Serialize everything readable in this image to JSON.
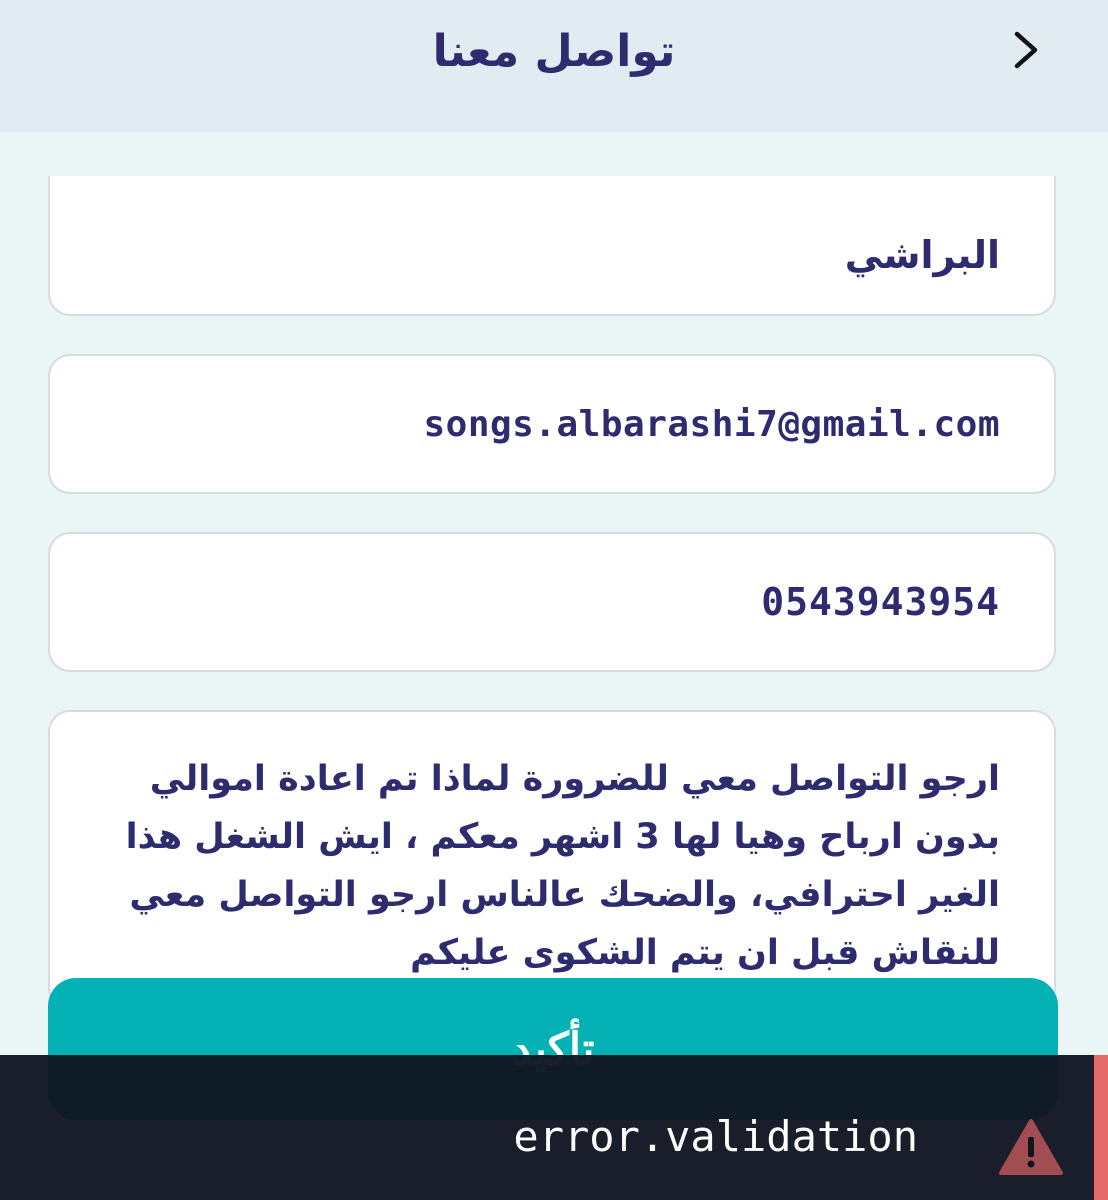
{
  "header": {
    "title": "تواصل معنا"
  },
  "form": {
    "name_value": "البراشي",
    "email_value": "songs.albarashi7@gmail.com",
    "phone_value": "0543943954",
    "message_value": "ارجو التواصل معي للضرورة لماذا تم اعادة اموالي بدون ارباح وهيا لها 3 اشهر معكم ، ايش الشغل هذا الغير احترافي، والضحك عالناس ارجو التواصل معي للنقاش قبل ان يتم الشكوى عليكم"
  },
  "confirm_button": {
    "label": "تأكيد"
  },
  "toast": {
    "message": "error.validation",
    "icon": "warning-icon",
    "accent_color": "#e66a6a"
  },
  "icons": {
    "back": "chevron-right-icon"
  },
  "colors": {
    "header_bg": "#e0ebf2",
    "page_bg": "#eaf6f6",
    "primary_text": "#2e2c6e",
    "button_bg": "#04b2b6",
    "toast_bg": "#111522"
  }
}
